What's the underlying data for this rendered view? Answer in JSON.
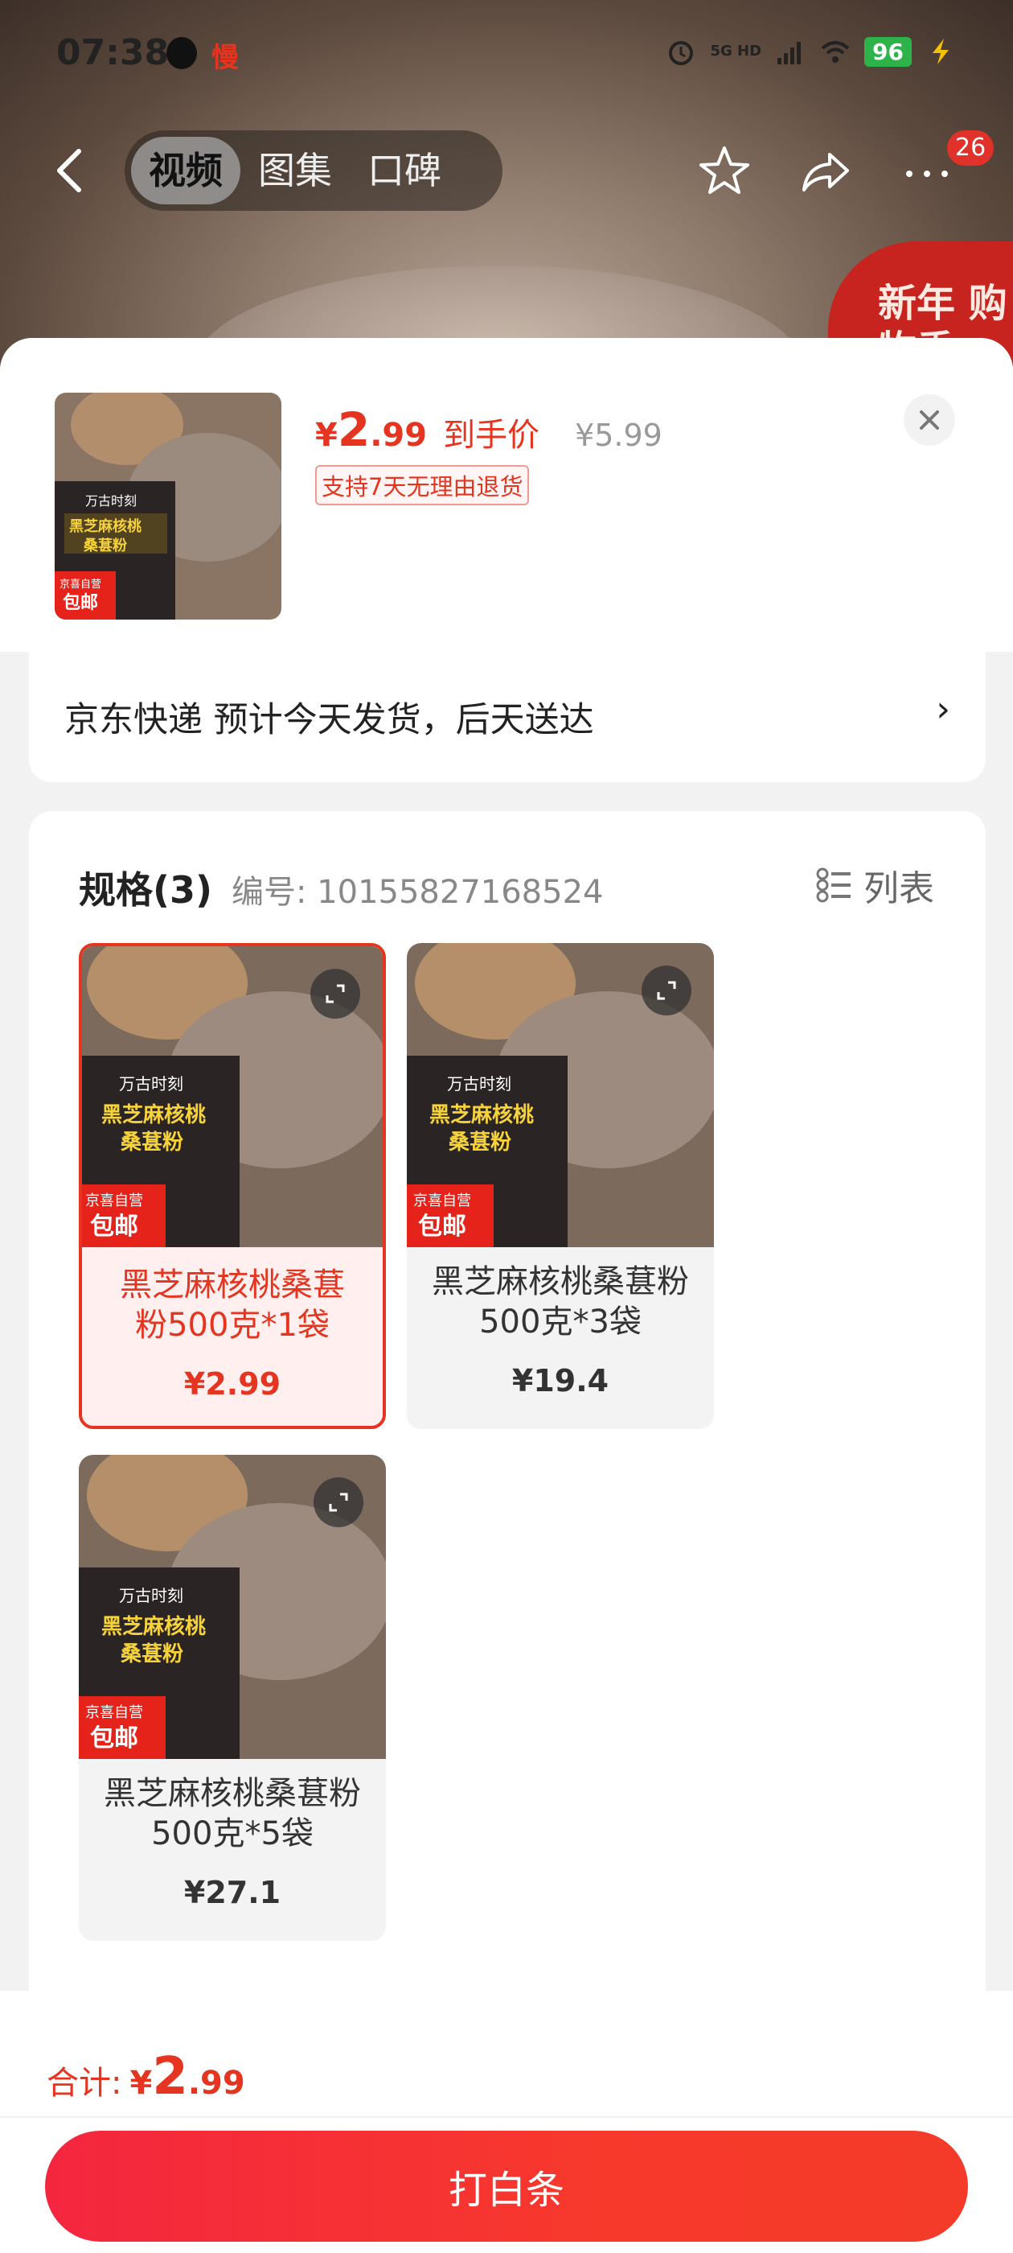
{
  "status_bar": {
    "time": "07:38",
    "slow_label": "慢",
    "network": "5G HD",
    "battery": "96"
  },
  "nav": {
    "tabs": [
      {
        "label": "视频",
        "active": true
      },
      {
        "label": "图集",
        "active": false
      },
      {
        "label": "口碑",
        "active": false
      }
    ],
    "badge_count": "26",
    "promo_corner": "新年 购物季"
  },
  "sheet": {
    "price": {
      "currency": "¥",
      "integer": "2",
      "decimal": ".99",
      "label": "到手价",
      "original": "¥5.99"
    },
    "return_policy": "支持7天无理由退货",
    "delivery": "京东快递 预计今天发货，后天送达"
  },
  "product_image": {
    "brand": "万古时刻",
    "title_line1": "黑芝麻核桃",
    "title_line2": "桑葚粉",
    "badge_top": "京喜自营",
    "badge_bottom": "包邮"
  },
  "spec": {
    "title": "规格(3)",
    "code": "编号: 10155827168524",
    "list_label": "列表",
    "items": [
      {
        "name": "黑芝麻核桃桑葚粉500克*1袋",
        "price": "¥2.99",
        "selected": true
      },
      {
        "name": "黑芝麻核桃桑葚粉500克*3袋",
        "price": "¥19.4",
        "selected": false
      },
      {
        "name": "黑芝麻核桃桑葚粉500克*5袋",
        "price": "¥27.1",
        "selected": false
      }
    ]
  },
  "footer": {
    "total_label": "合计:",
    "currency": "¥",
    "integer": "2",
    "decimal": ".99",
    "button_label": "打白条"
  },
  "colors": {
    "accent": "#e5341f",
    "button": "#f7392c",
    "battery": "#2db34a"
  }
}
